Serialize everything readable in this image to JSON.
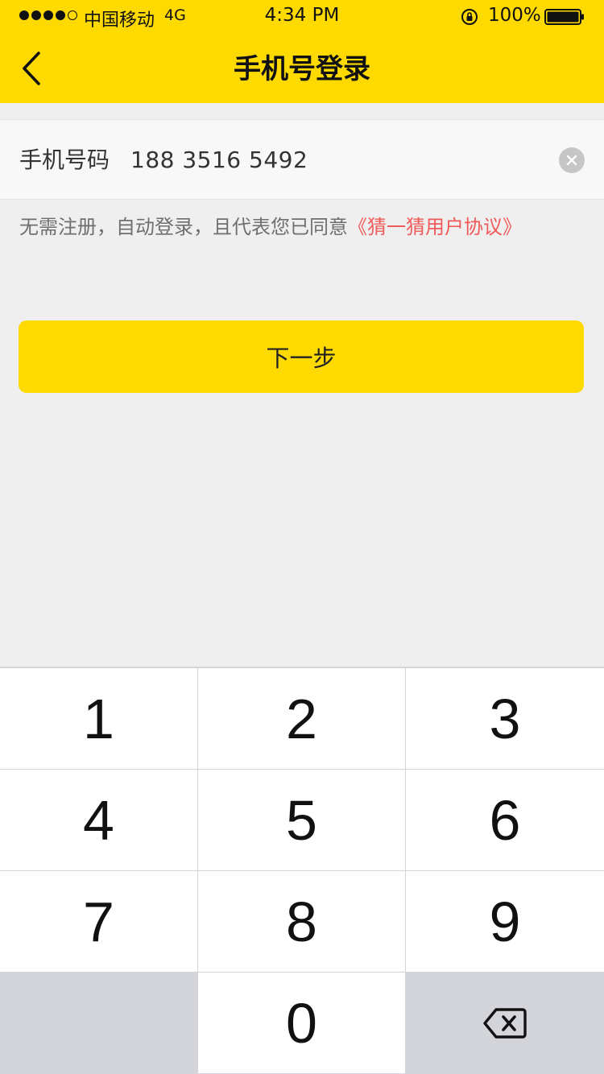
{
  "status_bar": {
    "carrier": "中国移动",
    "network": "4G",
    "time": "4:34 PM",
    "battery": "100%"
  },
  "nav": {
    "title": "手机号登录",
    "back_icon": "chevron-left-icon"
  },
  "phone_field": {
    "label": "手机号码",
    "value": "188 3516 5492",
    "clear_icon": "clear-icon"
  },
  "agreement": {
    "text": "无需注册，自动登录，且代表您已同意",
    "link": "《猜一猜用户协议》"
  },
  "next_button": {
    "label": "下一步"
  },
  "keypad": {
    "keys": [
      "1",
      "2",
      "3",
      "4",
      "5",
      "6",
      "7",
      "8",
      "9",
      "",
      "0",
      "⌫"
    ]
  },
  "colors": {
    "brand_yellow": "#FFDA00",
    "link_red": "#F05A5A",
    "background": "#EFEFEF",
    "keypad_dark": "#D3D5DB"
  }
}
